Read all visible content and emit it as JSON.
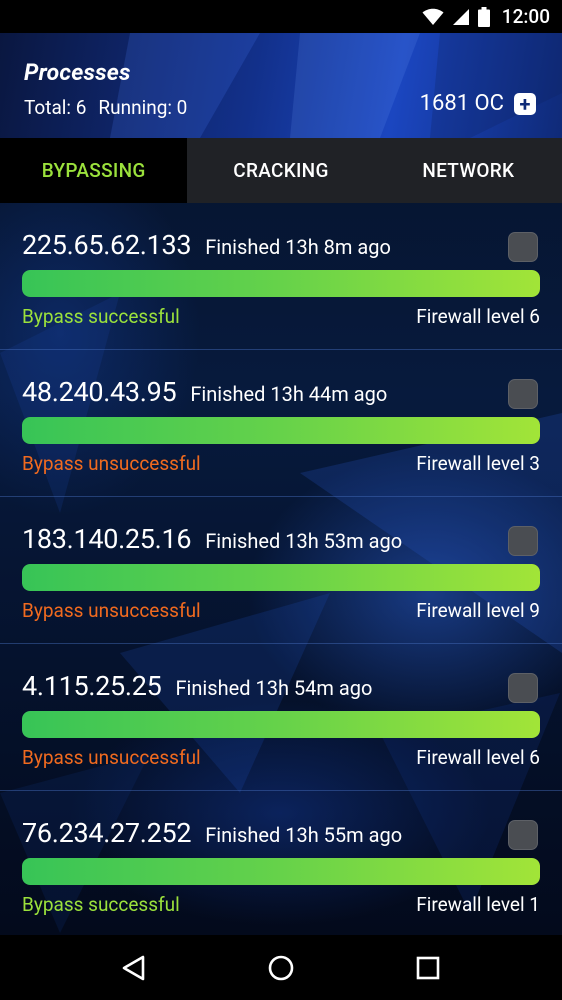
{
  "status_bar": {
    "time": "12:00",
    "icons": [
      "wifi-icon",
      "cell-signal-icon",
      "battery-icon"
    ]
  },
  "header": {
    "title": "Processes",
    "total_label": "Total: 6",
    "running_label": "Running: 0",
    "balance": "1681 OC",
    "add_icon": "plus-square-icon"
  },
  "tabs": [
    {
      "label": "BYPASSING",
      "active": true
    },
    {
      "label": "CRACKING",
      "active": false
    },
    {
      "label": "NETWORK",
      "active": false
    }
  ],
  "processes": [
    {
      "ip": "225.65.62.133",
      "finished": "Finished 13h 8m ago",
      "progress": 1.0,
      "status": "Bypass successful",
      "status_color": "#9be13c",
      "firewall": "Firewall level 6"
    },
    {
      "ip": "48.240.43.95",
      "finished": "Finished 13h 44m ago",
      "progress": 1.0,
      "status": "Bypass unsuccessful",
      "status_color": "#f06a1f",
      "firewall": "Firewall level 3"
    },
    {
      "ip": "183.140.25.16",
      "finished": "Finished 13h 53m ago",
      "progress": 1.0,
      "status": "Bypass unsuccessful",
      "status_color": "#f06a1f",
      "firewall": "Firewall level 9"
    },
    {
      "ip": "4.115.25.25",
      "finished": "Finished 13h 54m ago",
      "progress": 1.0,
      "status": "Bypass unsuccessful",
      "status_color": "#f06a1f",
      "firewall": "Firewall level 6"
    },
    {
      "ip": "76.234.27.252",
      "finished": "Finished 13h 55m ago",
      "progress": 1.0,
      "status": "Bypass successful",
      "status_color": "#9be13c",
      "firewall": "Firewall level 1"
    }
  ],
  "nav_bar": {
    "icons": [
      "back-icon",
      "home-icon",
      "recents-icon"
    ]
  },
  "colors": {
    "accent_green": "#9be13c",
    "fail_orange": "#f06a1f",
    "header_blue": "#1b46c0"
  }
}
